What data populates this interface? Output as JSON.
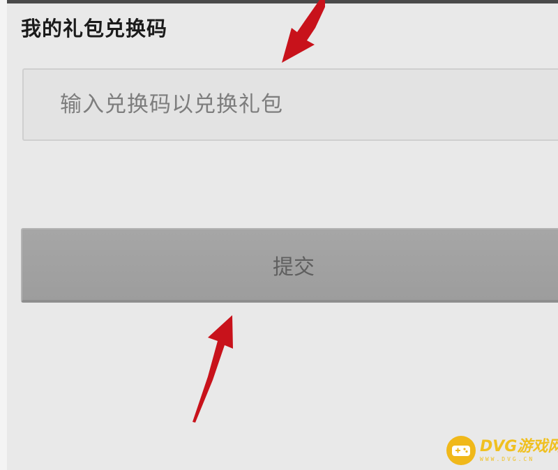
{
  "page": {
    "title": "我的礼包兑换码"
  },
  "redeem_form": {
    "code_value": "",
    "code_placeholder": "输入兑换码以兑换礼包",
    "submit_label": "提交"
  },
  "watermark": {
    "title": "DVG游戏网",
    "subtitle": "WWW.DVG.CN"
  },
  "annotations": {
    "arrow_color": "#d0141c",
    "arrows": [
      {
        "points_to": "code-input"
      },
      {
        "points_to": "submit-button"
      }
    ]
  },
  "colors": {
    "background": "#e9e9e9",
    "input_background": "#e3e3e3",
    "button_background": "#a2a2a2",
    "watermark_accent": "#f0b81a"
  }
}
